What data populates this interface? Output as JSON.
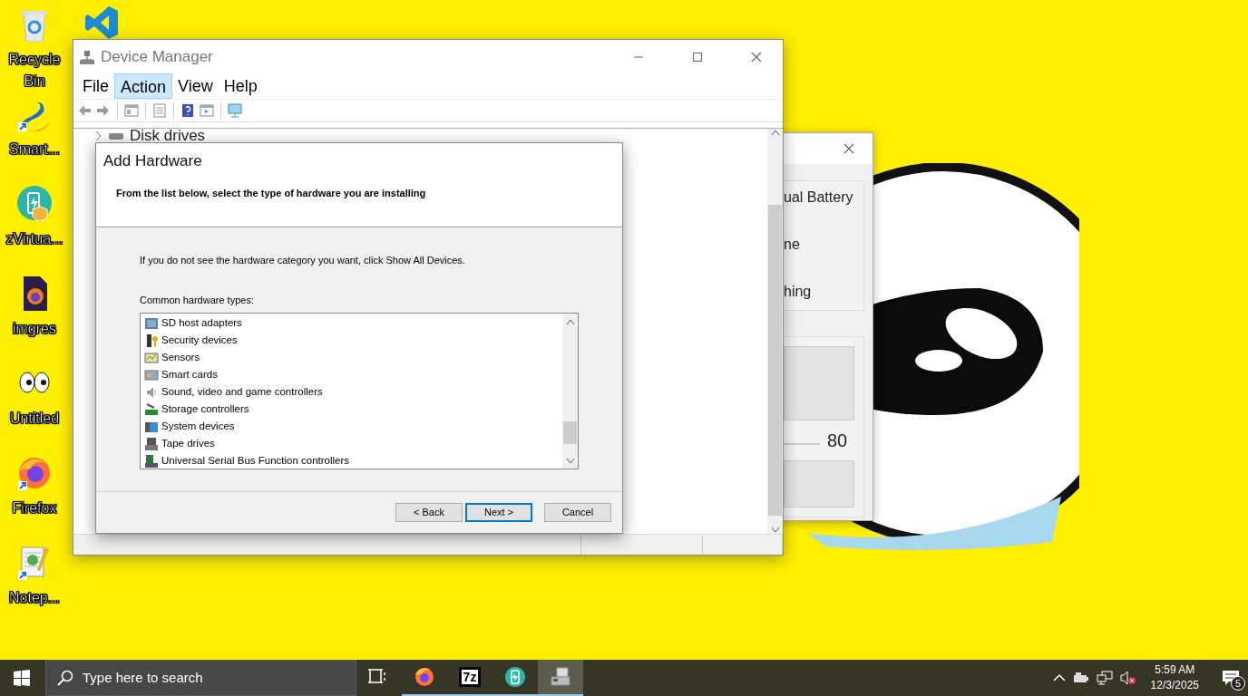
{
  "desktop_icons": [
    {
      "kind": "recycle",
      "label": "Recycle Bin"
    },
    {
      "kind": "swan",
      "label": "Smart..."
    },
    {
      "kind": "battery",
      "label": "zVirtua..."
    },
    {
      "kind": "imagefile",
      "label": "imgres"
    },
    {
      "kind": "eyes",
      "label": "Untitled"
    },
    {
      "kind": "firefox",
      "label": "Firefox"
    },
    {
      "kind": "notepad",
      "label": "Notep..."
    },
    {
      "kind": "code"
    }
  ],
  "device_manager": {
    "title": "Device Manager",
    "menu": [
      {
        "label": "File",
        "selected": false
      },
      {
        "label": "Action",
        "selected": true
      },
      {
        "label": "View",
        "selected": false
      },
      {
        "label": "Help",
        "selected": false
      }
    ],
    "tree": [
      {
        "label": "Disk drives",
        "expanded": false
      }
    ]
  },
  "background_window": {
    "texts": [
      "ual Battery",
      "ne",
      "hing"
    ],
    "reading": "80"
  },
  "dialog": {
    "title": "Add Hardware",
    "heading": "From the list below, select the type of hardware you are installing",
    "hint": "If you do not see the hardware category you want, click Show All Devices.",
    "list_label": "Common hardware types:",
    "items": [
      {
        "label": "SD host adapters",
        "kind": "sd",
        "selected": false
      },
      {
        "label": "Security devices",
        "kind": "security",
        "selected": false
      },
      {
        "label": "Sensors",
        "kind": "sensor",
        "selected": false
      },
      {
        "label": "Smart cards",
        "kind": "card",
        "selected": false
      },
      {
        "label": "Sound, video and game controllers",
        "kind": "sound",
        "selected": false
      },
      {
        "label": "Storage controllers",
        "kind": "storage",
        "selected": false
      },
      {
        "label": "System devices",
        "kind": "system",
        "selected": false
      },
      {
        "label": "Tape drives",
        "kind": "tape",
        "selected": false
      },
      {
        "label": "Universal Serial Bus Function controllers",
        "kind": "usb",
        "selected": false
      }
    ],
    "buttons": [
      {
        "label": "< Back",
        "default": false
      },
      {
        "label": "Next >",
        "default": true
      },
      {
        "label": "Cancel",
        "default": false
      }
    ]
  },
  "taskbar": {
    "search": {
      "placeholder": "Type here to search"
    },
    "apps": [
      {
        "kind": "taskview",
        "running": false,
        "selected": false
      },
      {
        "kind": "firefox",
        "running": true,
        "selected": false
      },
      {
        "kind": "archive",
        "label": "7z",
        "running": true,
        "selected": false
      },
      {
        "kind": "battery",
        "running": true,
        "selected": false
      },
      {
        "kind": "devmgr",
        "running": true,
        "selected": true
      }
    ],
    "time": "5:59 AM",
    "date": "12/3/2025",
    "notifications": "5"
  }
}
